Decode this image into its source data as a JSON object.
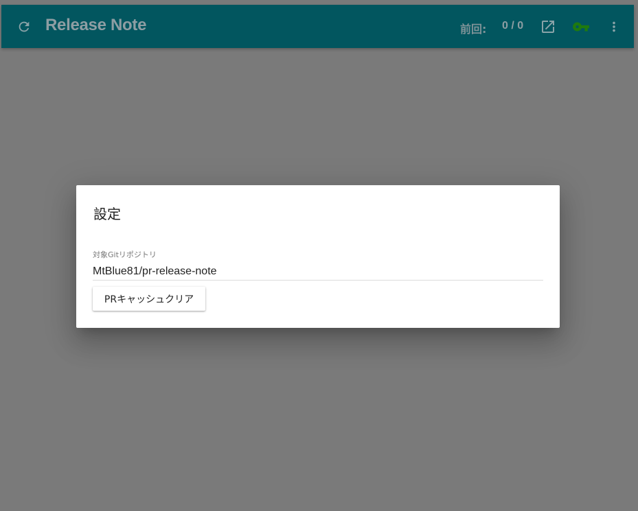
{
  "appbar": {
    "title": "Release Note",
    "prev_label": "前回:",
    "prev_count": "0 / 0",
    "icons": {
      "refresh": "refresh-icon",
      "open": "open-in-new-icon",
      "key": "key-icon",
      "more": "more-vert-icon"
    },
    "colors": {
      "bar": "#02565f",
      "key": "#1f7a0f",
      "text": "#8e9ea3"
    }
  },
  "dialog": {
    "title": "設定",
    "repo_label": "対象Gitリポジトリ",
    "repo_value": "MtBlue81/pr-release-note",
    "clear_button": "PRキャッシュクリア"
  }
}
